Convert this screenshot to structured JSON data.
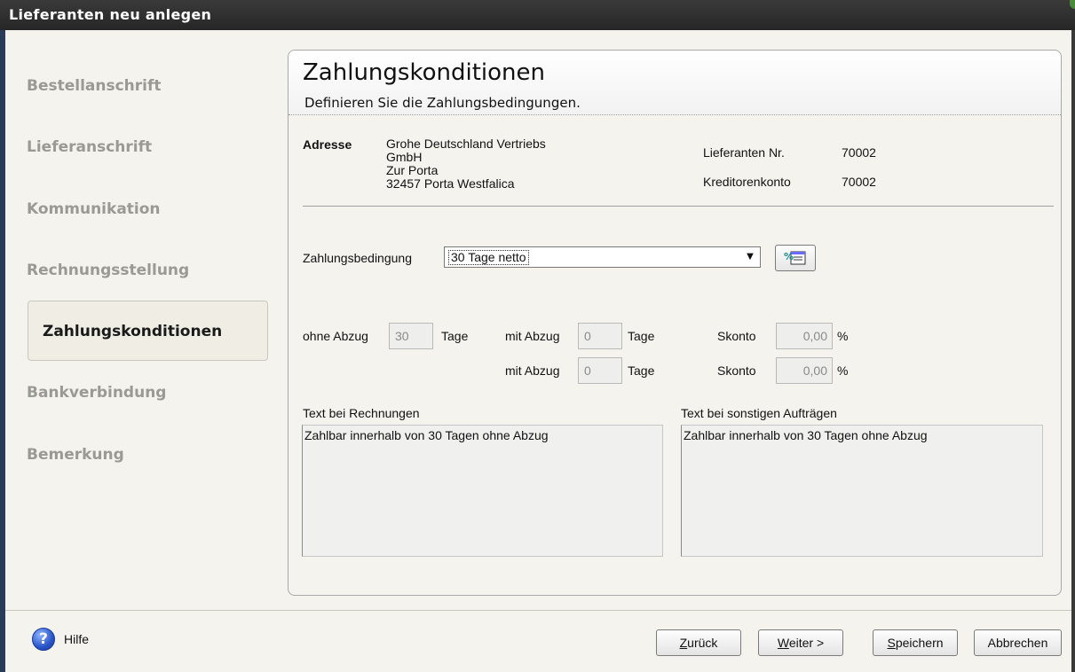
{
  "window": {
    "title": "Lieferanten neu anlegen"
  },
  "sidebar": {
    "items": [
      {
        "label": "Bestellanschrift"
      },
      {
        "label": "Lieferanschrift"
      },
      {
        "label": "Kommunikation"
      },
      {
        "label": "Rechnungsstellung"
      },
      {
        "label": "Zahlungskonditionen",
        "active": true
      },
      {
        "label": "Bankverbindung"
      },
      {
        "label": "Bemerkung"
      }
    ]
  },
  "panel": {
    "title": "Zahlungskonditionen",
    "subtitle": "Definieren Sie die Zahlungsbedingungen."
  },
  "address": {
    "label": "Adresse",
    "lines": [
      "Grohe Deutschland Vertriebs",
      "GmbH",
      "Zur Porta",
      "32457 Porta Westfalica"
    ]
  },
  "supplier": {
    "number_label": "Lieferanten Nr.",
    "number": "70002",
    "account_label": "Kreditorenkonto",
    "account": "70002"
  },
  "payment": {
    "condition_label": "Zahlungsbedingung",
    "condition_value": "30 Tage netto",
    "ohne_abzug_label": "ohne Abzug",
    "ohne_abzug_value": "30",
    "days_label": "Tage",
    "mit_abzug_label": "mit Abzug",
    "mit_abzug_1": "0",
    "mit_abzug_2": "0",
    "skonto_label": "Skonto",
    "skonto_1": "0,00",
    "skonto_2": "0,00",
    "percent": "%"
  },
  "texts": {
    "invoice_label": "Text bei Rechnungen",
    "invoice_text": "Zahlbar innerhalb von 30 Tagen ohne Abzug",
    "other_label": "Text bei sonstigen Aufträgen",
    "other_text": "Zahlbar innerhalb von 30 Tagen ohne Abzug"
  },
  "footer": {
    "help": "Hilfe",
    "back_u": "Z",
    "back_rest": "urück",
    "next_u": "W",
    "next_rest": "eiter >",
    "save_u": "S",
    "save_rest": "peichern",
    "cancel": "Abbrechen"
  },
  "colors": {
    "titlebar": "#2f2f2f",
    "panel_bg": "#f4f3ee",
    "nav_inactive": "#9a9a95"
  }
}
